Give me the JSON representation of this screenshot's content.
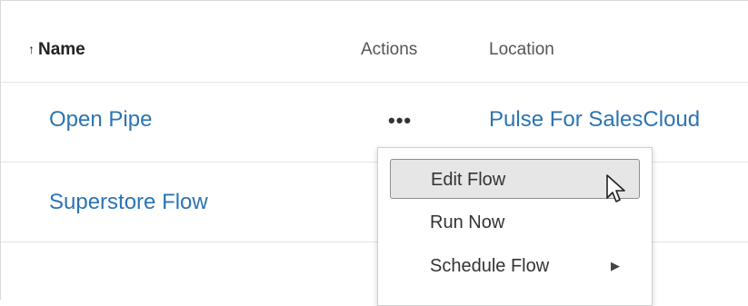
{
  "table": {
    "columns": {
      "name": {
        "sort_indicator": "↑",
        "label": "Name"
      },
      "actions": {
        "label": "Actions"
      },
      "location": {
        "label": "Location"
      }
    },
    "rows": [
      {
        "name": "Open Pipe",
        "actions": "•••",
        "location": "Pulse For SalesCloud"
      },
      {
        "name": "Superstore Flow",
        "actions": "",
        "location": ""
      }
    ]
  },
  "context_menu": {
    "items": [
      {
        "label": "Edit Flow",
        "highlighted": true
      },
      {
        "label": "Run Now"
      },
      {
        "label": "Schedule Flow",
        "submenu_icon": "triangle-right-icon"
      }
    ],
    "submenu_arrow": "▶"
  },
  "colors": {
    "link": "#2c74b3",
    "highlight_bg": "#e6e6e6",
    "text": "#333333"
  },
  "icons": {
    "cursor": "mouse-pointer-icon"
  }
}
